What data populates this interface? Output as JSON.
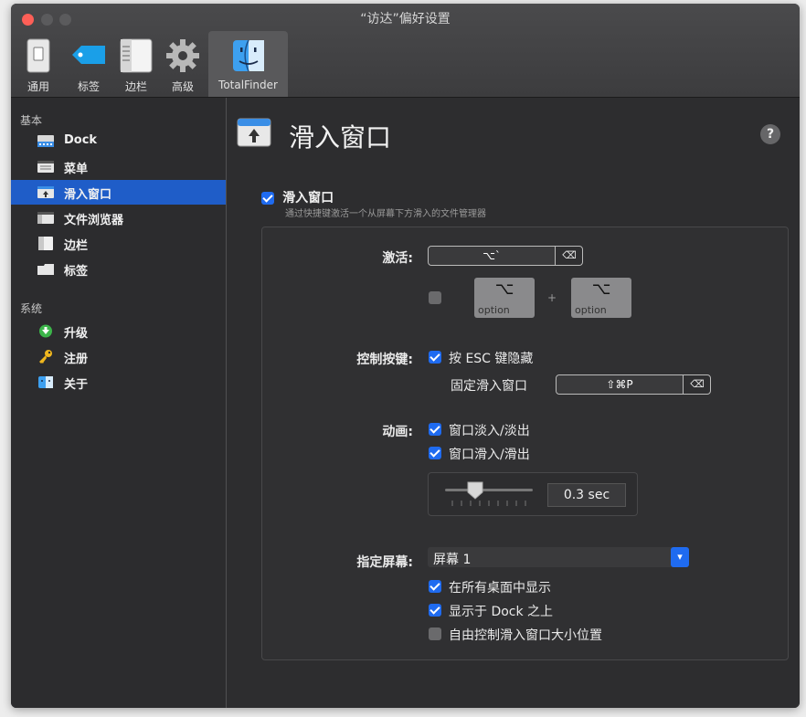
{
  "window": {
    "title": "“访达”偏好设置"
  },
  "toolbar": {
    "items": [
      {
        "label": "通用",
        "icon": "general-switch-icon"
      },
      {
        "label": "标签",
        "icon": "tag-icon"
      },
      {
        "label": "边栏",
        "icon": "sidebar-icon"
      },
      {
        "label": "高级",
        "icon": "gear-icon"
      },
      {
        "label": "TotalFinder",
        "icon": "finder-icon",
        "active": true
      }
    ]
  },
  "sidebar": {
    "section_basic": "基本",
    "section_system": "系统",
    "basic_items": [
      {
        "label": "Dock",
        "icon": "dock-icon"
      },
      {
        "label": "菜单",
        "icon": "menu-icon"
      },
      {
        "label": "滑入窗口",
        "icon": "visor-window-icon",
        "selected": true
      },
      {
        "label": "文件浏览器",
        "icon": "browser-icon"
      },
      {
        "label": "边栏",
        "icon": "sidebar-icon"
      },
      {
        "label": "标签",
        "icon": "tab-folder-icon"
      }
    ],
    "system_items": [
      {
        "label": "升级",
        "icon": "upgrade-icon"
      },
      {
        "label": "注册",
        "icon": "key-icon"
      },
      {
        "label": "关于",
        "icon": "about-icon"
      }
    ]
  },
  "main": {
    "title": "滑入窗口",
    "help": "?",
    "enable": {
      "label": "滑入窗口",
      "description": "通过快捷键激活一个从屏幕下方滑入的文件管理器",
      "checked": true
    },
    "activate": {
      "label": "激活:",
      "shortcut": "⌥`",
      "clear": "⌫",
      "double_tap_checked": false,
      "key1_symbol": "⌥",
      "key1_label": "option",
      "plus": "+",
      "key2_symbol": "⌥",
      "key2_label": "option"
    },
    "control_keys": {
      "label": "控制按键:",
      "esc_hide": "按 ESC 键隐藏",
      "esc_checked": true,
      "pin_label": "固定滑入窗口",
      "pin_shortcut": "⇧⌘P",
      "clear": "⌫"
    },
    "animation": {
      "label": "动画:",
      "fade": "窗口淡入/淡出",
      "fade_checked": true,
      "slide": "窗口滑入/滑出",
      "slide_checked": true,
      "duration": "0.3 sec"
    },
    "screen": {
      "label": "指定屏幕:",
      "selected": "屏幕 1",
      "all_desktops": "在所有桌面中显示",
      "all_desktops_checked": true,
      "above_dock": "显示于 Dock 之上",
      "above_dock_checked": true,
      "free_resize": "自由控制滑入窗口大小位置",
      "free_resize_checked": false
    }
  }
}
